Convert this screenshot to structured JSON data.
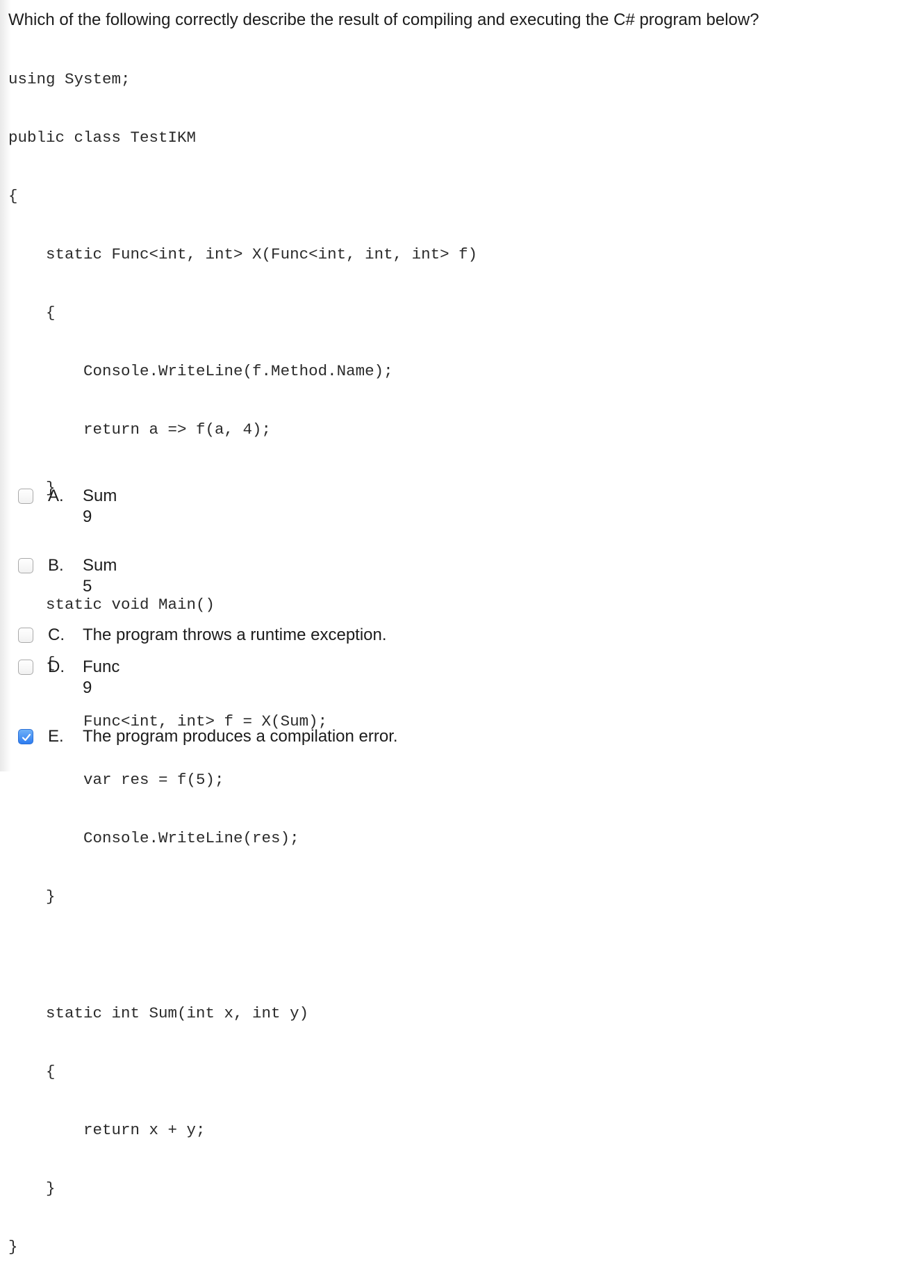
{
  "question": "Which of the following correctly describe the result of compiling and executing the C# program below?",
  "code_lines": [
    "using System;",
    "public class TestIKM",
    "{",
    "    static Func<int, int> X(Func<int, int, int> f)",
    "    {",
    "        Console.WriteLine(f.Method.Name);",
    "        return a => f(a, 4);",
    "    }",
    "",
    "    static void Main()",
    "    {",
    "        Func<int, int> f = X(Sum);",
    "        var res = f(5);",
    "        Console.WriteLine(res);",
    "    }",
    "",
    "    static int Sum(int x, int y)",
    "    {",
    "        return x + y;",
    "    }",
    "}"
  ],
  "options": [
    {
      "letter": "A.",
      "lines": [
        "Sum",
        "9"
      ],
      "checked": false
    },
    {
      "letter": "B.",
      "lines": [
        "Sum",
        "5"
      ],
      "checked": false
    },
    {
      "letter": "C.",
      "lines": [
        "The program throws a runtime exception."
      ],
      "checked": false
    },
    {
      "letter": "D.",
      "lines": [
        "Func",
        "9"
      ],
      "checked": false
    },
    {
      "letter": "E.",
      "lines": [
        "The program produces a compilation error."
      ],
      "checked": true
    }
  ],
  "colors": {
    "check_accent": "#2d7cf0",
    "text": "#1c1c1c"
  },
  "icons": {
    "checked": "checkmark-icon"
  }
}
